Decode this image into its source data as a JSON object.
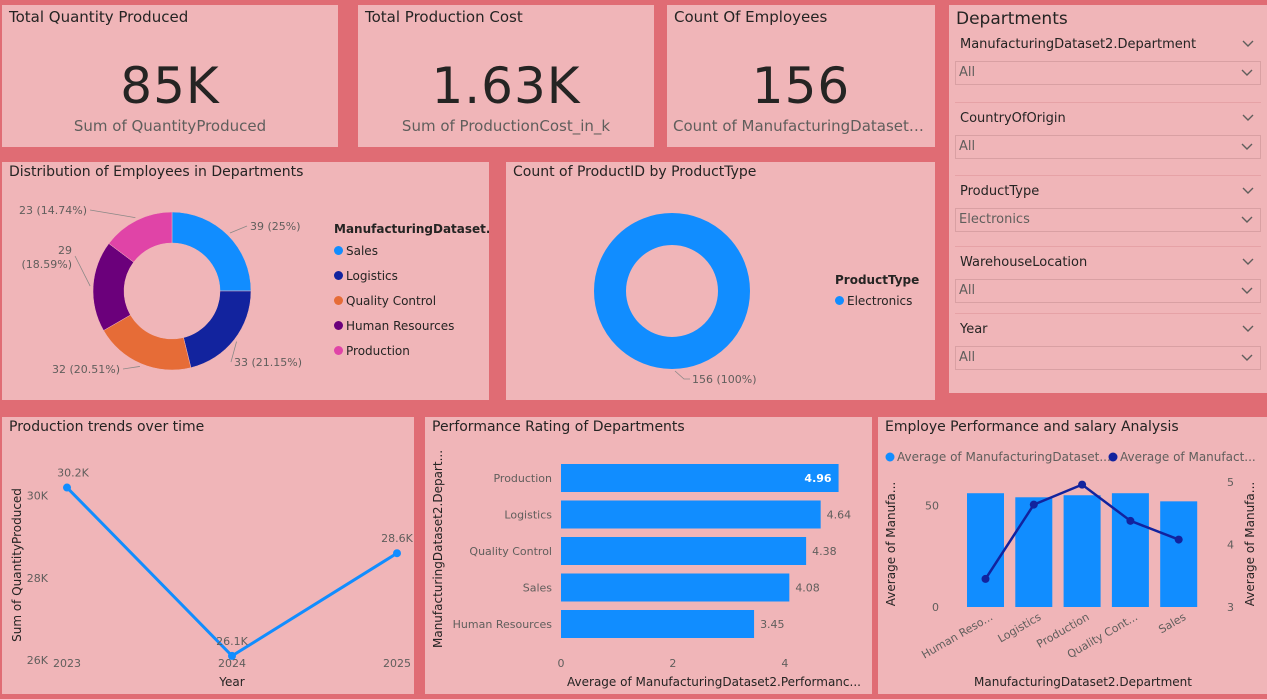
{
  "kpis": [
    {
      "title": "Total Quantity Produced",
      "value": "85K",
      "subtitle": "Sum of QuantityProduced"
    },
    {
      "title": "Total Production Cost",
      "value": "1.63K",
      "subtitle": "Sum of ProductionCost_in_k"
    },
    {
      "title": "Count Of Employees",
      "value": "156",
      "subtitle": "Count of ManufacturingDataset2.E..."
    }
  ],
  "slicers": {
    "title": "Departments",
    "items": [
      {
        "label": "ManufacturingDataset2.Department",
        "value": "All"
      },
      {
        "label": "CountryOfOrigin",
        "value": "All"
      },
      {
        "label": "ProductType",
        "value": "Electronics"
      },
      {
        "label": "WarehouseLocation",
        "value": "All"
      },
      {
        "label": "Year",
        "value": "All"
      }
    ]
  },
  "colors": {
    "sales": "#118dff",
    "logistics": "#12239e",
    "quality_control": "#e66c37",
    "human_resources": "#6b007b",
    "production": "#e044a7",
    "bar": "#118dff",
    "line": "#12239e"
  },
  "chart_data": [
    {
      "type": "pie",
      "title": "Distribution of Employees in Departments",
      "legend_title": "ManufacturingDataset...",
      "legend_position": "right",
      "categories": [
        "Sales",
        "Logistics",
        "Quality Control",
        "Human Resources",
        "Production"
      ],
      "values": [
        39,
        33,
        32,
        29,
        23
      ],
      "data_labels": [
        "39 (25%)",
        "33 (21.15%)",
        "32 (20.51%)",
        "29 (18.59%)",
        "23 (14.74%)"
      ]
    },
    {
      "type": "pie",
      "title": "Count of ProductID by ProductType",
      "legend_title": "ProductType",
      "legend_position": "right",
      "categories": [
        "Electronics"
      ],
      "values": [
        156
      ],
      "data_labels": [
        "156 (100%)"
      ]
    },
    {
      "type": "line",
      "title": "Production trends over time",
      "xlabel": "Year",
      "ylabel": "Sum of QuantityProduced",
      "x": [
        "2023",
        "2024",
        "2025"
      ],
      "values": [
        30200,
        26100,
        28600
      ],
      "data_labels": [
        "30.2K",
        "26.1K",
        "28.6K"
      ],
      "y_ticks": [
        "26K",
        "28K",
        "30K"
      ],
      "ylim": [
        26000,
        30700
      ]
    },
    {
      "type": "bar",
      "orientation": "horizontal",
      "title": "Performance Rating of Departments",
      "xlabel": "Average of ManufacturingDataset2.Performanc...",
      "ylabel": "ManufacturingDataset2.Depart...",
      "categories": [
        "Production",
        "Logistics",
        "Quality Control",
        "Sales",
        "Human Resources"
      ],
      "values": [
        4.96,
        4.64,
        4.38,
        4.08,
        3.45
      ],
      "data_labels": [
        "4.96",
        "4.64",
        "4.38",
        "4.08",
        "3.45"
      ],
      "x_ticks": [
        "0",
        "2",
        "4"
      ],
      "xlim": [
        0,
        5.2
      ]
    },
    {
      "type": "bar",
      "title": "Employe Performance and salary Analysis",
      "xlabel": "ManufacturingDataset2.Department",
      "ylabel": "Average of Manufa...",
      "y2label": "Average of Manufa...",
      "categories": [
        "Human Reso...",
        "Logistics",
        "Production",
        "Quality Cont...",
        "Sales"
      ],
      "series": [
        {
          "name": "Average of ManufacturingDataset...",
          "values": [
            56,
            54,
            55,
            56,
            52
          ]
        },
        {
          "name": "Average of Manufact...",
          "values": [
            3.45,
            4.64,
            4.96,
            4.38,
            4.08
          ]
        }
      ],
      "y_ticks": [
        "0",
        "50"
      ],
      "y2_ticks": [
        "3",
        "4",
        "5"
      ],
      "ylim": [
        0,
        63
      ],
      "y2lim": [
        3,
        5.05
      ]
    }
  ]
}
